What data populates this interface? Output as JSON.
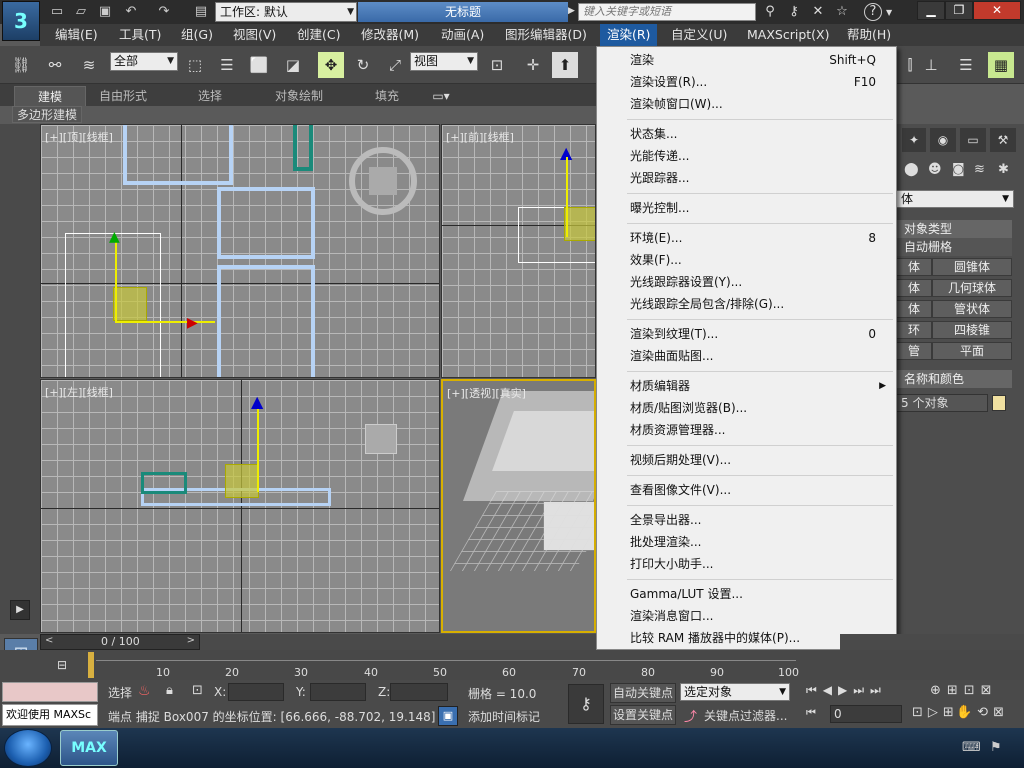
{
  "titlebar": {
    "logo": "3",
    "workspace_prefix": "工作区:",
    "workspace_value": "默认",
    "document_title": "无标题",
    "search_placeholder": "键入关键字或短语",
    "help": "?"
  },
  "menubar": {
    "items": [
      "编辑(E)",
      "工具(T)",
      "组(G)",
      "视图(V)",
      "创建(C)",
      "修改器(M)",
      "动画(A)",
      "图形编辑器(D)",
      "渲染(R)",
      "自定义(U)",
      "MAXScript(X)",
      "帮助(H)"
    ]
  },
  "toolbar": {
    "selection_filter": "全部",
    "coord_system": "视图"
  },
  "ribbon": {
    "tabs": [
      "建模",
      "自由形式",
      "选择",
      "对象绘制",
      "填充"
    ],
    "panel_label": "多边形建模"
  },
  "viewports": {
    "top": "[+][顶][线框]",
    "front": "[+][前][线框]",
    "left": "[+][左][线框]",
    "perspective": "[+][透视][真实]"
  },
  "command_panel": {
    "category": "标准基本体",
    "category_visible": "体",
    "rollout_object_type": "对象类型",
    "autogrid": "自动栅格",
    "buttons_left": [
      "体",
      "体",
      "体",
      "环",
      "管"
    ],
    "buttons_right": [
      "圆锥体",
      "几何球体",
      "管状体",
      "四棱锥",
      "平面"
    ],
    "rollout_name_color": "名称和颜色",
    "selected_objects": "5 个对象"
  },
  "render_menu": {
    "items": [
      {
        "label": "渲染",
        "shortcut": "Shift+Q"
      },
      {
        "label": "渲染设置(R)...",
        "shortcut": "F10"
      },
      {
        "label": "渲染帧窗口(W)...",
        "shortcut": ""
      },
      {
        "label": "状态集...",
        "shortcut": ""
      },
      {
        "label": "光能传递...",
        "shortcut": ""
      },
      {
        "label": "光跟踪器...",
        "shortcut": ""
      },
      {
        "label": "曝光控制...",
        "shortcut": ""
      },
      {
        "label": "环境(E)...",
        "shortcut": "8"
      },
      {
        "label": "效果(F)...",
        "shortcut": ""
      },
      {
        "label": "光线跟踪器设置(Y)...",
        "shortcut": ""
      },
      {
        "label": "光线跟踪全局包含/排除(G)...",
        "shortcut": ""
      },
      {
        "label": "渲染到纹理(T)...",
        "shortcut": "0"
      },
      {
        "label": "渲染曲面贴图...",
        "shortcut": ""
      },
      {
        "label": "材质编辑器",
        "shortcut": "",
        "submenu": "▶"
      },
      {
        "label": "材质/贴图浏览器(B)...",
        "shortcut": ""
      },
      {
        "label": "材质资源管理器...",
        "shortcut": ""
      },
      {
        "label": "视频后期处理(V)...",
        "shortcut": ""
      },
      {
        "label": "查看图像文件(V)...",
        "shortcut": ""
      },
      {
        "label": "全景导出器...",
        "shortcut": ""
      },
      {
        "label": "批处理渲染...",
        "shortcut": ""
      },
      {
        "label": "打印大小助手...",
        "shortcut": ""
      },
      {
        "label": "Gamma/LUT 设置...",
        "shortcut": ""
      },
      {
        "label": "渲染消息窗口...",
        "shortcut": ""
      },
      {
        "label": "比较 RAM 播放器中的媒体(P)...",
        "shortcut": ""
      }
    ]
  },
  "timeline": {
    "slider_label": "0 / 100",
    "ticks": [
      "10",
      "20",
      "30",
      "40",
      "50",
      "60",
      "70",
      "80",
      "90",
      "100"
    ]
  },
  "status": {
    "maxscript_prompt": "欢迎使用 MAXSc",
    "select_label": "选择",
    "x_label": "X:",
    "y_label": "Y:",
    "z_label": "Z:",
    "grid": "栅格 = 10.0",
    "auto_key": "自动关键点",
    "selected_object": "选定对象",
    "set_key": "设置关键点",
    "key_filters": "关键点过滤器...",
    "frame_value": "0",
    "prompt_text": "端点 捕捉 Box007 的坐标位置:  [66.666, -88.702, 19.148]",
    "add_time_tag": "添加时间标记"
  },
  "taskbar": {
    "app_label": "MAX"
  }
}
